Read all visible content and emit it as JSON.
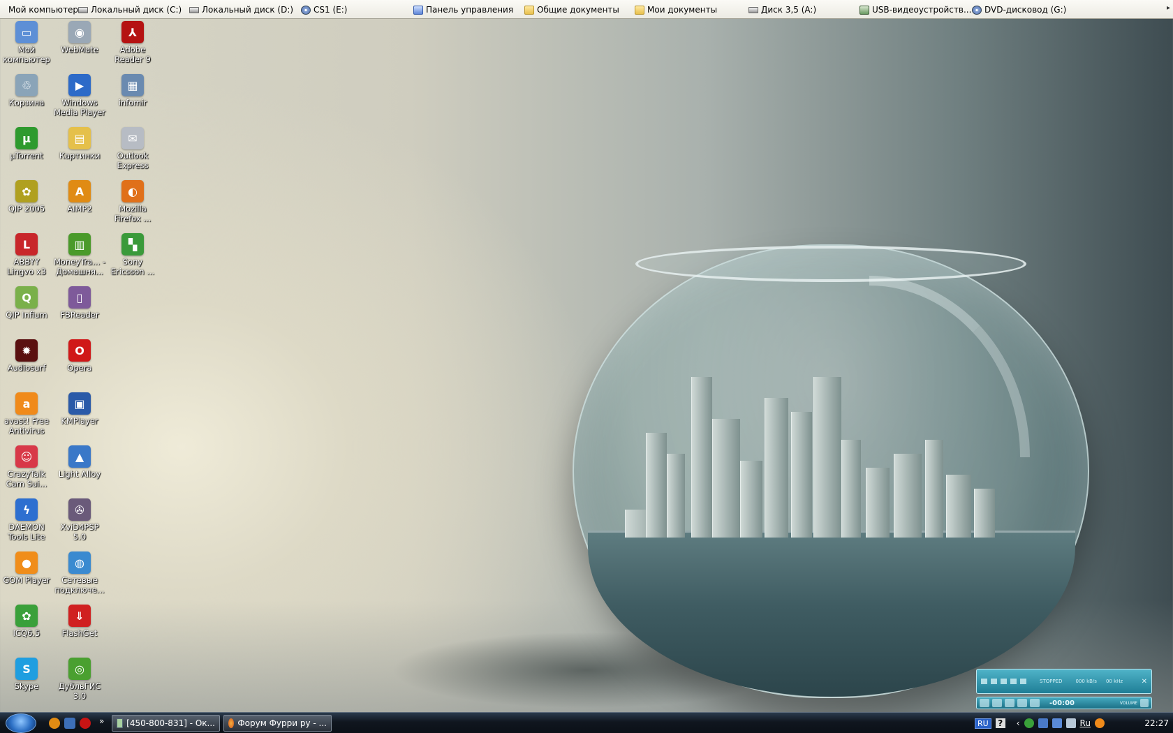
{
  "toolbar": {
    "items": [
      {
        "label": "Мой компьютер",
        "icon": ""
      },
      {
        "label": "Локальный диск (C:)",
        "icon": "drive-icon"
      },
      {
        "label": "Локальный диск (D:)",
        "icon": "drive-icon"
      },
      {
        "label": "CS1 (E:)",
        "icon": "cd-icon"
      },
      {
        "label": "Панель управления",
        "icon": "control-panel-icon"
      },
      {
        "label": "Общие документы",
        "icon": "folder-icon"
      },
      {
        "label": "Мои документы",
        "icon": "folder-icon"
      },
      {
        "label": "Диск 3,5 (A:)",
        "icon": "floppy-icon"
      },
      {
        "label": "USB-видеоустройств...",
        "icon": "usb-camera-icon"
      },
      {
        "label": "DVD-дисковод (G:)",
        "icon": "dvd-icon"
      }
    ],
    "overflow": "▸"
  },
  "desktop_icons": [
    {
      "label": "Мой компьютер",
      "icon": "my-computer-icon",
      "color": "#5d8fd6",
      "glyph": "▭"
    },
    {
      "label": "Корзина",
      "icon": "recycle-bin-icon",
      "color": "#8aa4b8",
      "glyph": "♲"
    },
    {
      "label": "µTorrent",
      "icon": "utorrent-icon",
      "color": "#2e9a2e",
      "glyph": "µ"
    },
    {
      "label": "QIP 2005",
      "icon": "qip-icon",
      "color": "#b0a020",
      "glyph": "✿"
    },
    {
      "label": "ABBYY Lingvo x3",
      "icon": "lingvo-icon",
      "color": "#c8262a",
      "glyph": "L"
    },
    {
      "label": "QIP Infium",
      "icon": "qip-infium-icon",
      "color": "#7ab04a",
      "glyph": "Q"
    },
    {
      "label": "Audiosurf",
      "icon": "audiosurf-icon",
      "color": "#5a1010",
      "glyph": "✹"
    },
    {
      "label": "avast! Free Antivirus",
      "icon": "avast-icon",
      "color": "#f08a1a",
      "glyph": "a"
    },
    {
      "label": "CrazyTalk Cam Sui...",
      "icon": "crazytalk-icon",
      "color": "#d83848",
      "glyph": "☺"
    },
    {
      "label": "DAEMON Tools Lite",
      "icon": "daemon-tools-icon",
      "color": "#2d6fd0",
      "glyph": "ϟ"
    },
    {
      "label": "GOM Player",
      "icon": "gom-player-icon",
      "color": "#f08d1a",
      "glyph": "●"
    },
    {
      "label": "ICQ6.5",
      "icon": "icq-icon",
      "color": "#3aa03a",
      "glyph": "✿"
    },
    {
      "label": "Skype",
      "icon": "skype-icon",
      "color": "#1f9ee0",
      "glyph": "S"
    },
    {
      "label": "WebMate",
      "icon": "webcam-icon",
      "color": "#9aa8b6",
      "glyph": "◉"
    },
    {
      "label": "Windows Media Player",
      "icon": "media-player-icon",
      "color": "#2c6ac8",
      "glyph": "▶"
    },
    {
      "label": "Картинки",
      "icon": "folder-icon",
      "color": "#e5c04a",
      "glyph": "▤"
    },
    {
      "label": "AIMP2",
      "icon": "aimp-icon",
      "color": "#e08b14",
      "glyph": "A"
    },
    {
      "label": "MoneyTra... - Домашня...",
      "icon": "money-tracker-icon",
      "color": "#4a9a2a",
      "glyph": "▥"
    },
    {
      "label": "FBReader",
      "icon": "fbreader-icon",
      "color": "#7e5a9a",
      "glyph": "▯"
    },
    {
      "label": "Opera",
      "icon": "opera-icon",
      "color": "#d01818",
      "glyph": "O"
    },
    {
      "label": "KMPlayer",
      "icon": "kmplayer-icon",
      "color": "#2a5aa8",
      "glyph": "▣"
    },
    {
      "label": "Light Alloy",
      "icon": "light-alloy-icon",
      "color": "#3a78c8",
      "glyph": "▲"
    },
    {
      "label": "XviD4PSP 5.0",
      "icon": "xvid4psp-icon",
      "color": "#6a5a7a",
      "glyph": "✇"
    },
    {
      "label": "Сетевые подключе...",
      "icon": "network-connections-icon",
      "color": "#3a8ad0",
      "glyph": "◍"
    },
    {
      "label": "FlashGet",
      "icon": "flashget-icon",
      "color": "#d02020",
      "glyph": "⇓"
    },
    {
      "label": "ДубльГИС 3.0",
      "icon": "2gis-icon",
      "color": "#4aa030",
      "glyph": "◎"
    },
    {
      "label": "Adobe Reader 9",
      "icon": "adobe-reader-icon",
      "color": "#b51212",
      "glyph": "⅄"
    },
    {
      "label": "infomir",
      "icon": "infomir-icon",
      "color": "#6a8ab0",
      "glyph": "▦"
    },
    {
      "label": "Outlook Express",
      "icon": "outlook-express-icon",
      "color": "#b7bcc4",
      "glyph": "✉"
    },
    {
      "label": "Mozilla Firefox ...",
      "icon": "firefox-icon",
      "color": "#e0701a",
      "glyph": "◐"
    },
    {
      "label": "Sony Ericsson ...",
      "icon": "sony-ericsson-icon",
      "color": "#3a9a3a",
      "glyph": "▚"
    }
  ],
  "player": {
    "status": "STOPPED",
    "bitrate": "000 kB/s",
    "frequency": "00 kHz",
    "time": "-00:00",
    "volume_label": "VOLUME"
  },
  "taskbar": {
    "quick_launch": [
      "aimp-icon",
      "media-icon",
      "opera-icon"
    ],
    "overflow": "»",
    "tasks": [
      {
        "label": "[450-800-831] - Ок...",
        "icon": "notepad-icon"
      },
      {
        "label": "Форум Фурри ру - ...",
        "icon": "firefox-icon"
      }
    ],
    "tray": {
      "lang": "RU",
      "help": "?",
      "chevron": "‹",
      "lang2": "Ru",
      "clock": "22:27"
    }
  }
}
